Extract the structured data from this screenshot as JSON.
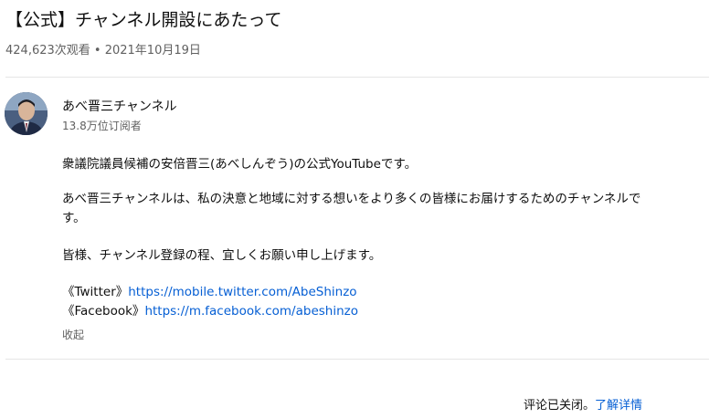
{
  "video": {
    "title": "【公式】チャンネル開設にあたって",
    "views": "424,623次观看",
    "separator": "•",
    "date": "2021年10月19日"
  },
  "channel": {
    "avatar": "avatar-photo",
    "name": "あべ晋三チャンネル",
    "subscribers": "13.8万位订阅者"
  },
  "description": {
    "line1": "衆議院議員候補の安倍晋三(あべしんぞう)の公式YouTubeです。",
    "line2": "あべ晋三チャンネルは、私の決意と地域に対する想いをより多くの皆様にお届けするためのチャンネルです。",
    "line3": "皆様、チャンネル登録の程、宜しくお願い申し上げます。",
    "links": [
      {
        "label": "《Twitter》",
        "url": "https://mobile.twitter.com/AbeShinzo"
      },
      {
        "label": "《Facebook》",
        "url": "https://m.facebook.com/abeshinzo"
      }
    ],
    "show_less": "收起"
  },
  "comments": {
    "status": "评论已关闭。",
    "learn_more": "了解详情"
  },
  "colors": {
    "link": "#065fd4",
    "secondary_text": "#606060",
    "divider": "#e5e5e5"
  }
}
